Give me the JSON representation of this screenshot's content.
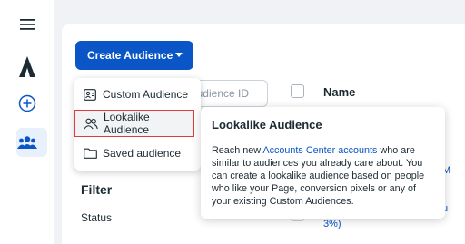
{
  "create_button": {
    "label": "Create Audience"
  },
  "search": {
    "placeholder": "udience ID"
  },
  "table": {
    "name_header": "Name"
  },
  "menu": {
    "items": [
      {
        "label": "Custom Audience",
        "icon": "custom-audience-icon"
      },
      {
        "label": "Lookalike Audience",
        "icon": "lookalike-people-icon",
        "highlighted": true
      },
      {
        "label": "Saved audience",
        "icon": "folder-icon"
      }
    ]
  },
  "filters": {
    "title": "Filter",
    "status_label": "Status"
  },
  "tooltip": {
    "title": "Lookalike Audience",
    "body_prefix": "Reach new ",
    "link_text": "Accounts Center accounts",
    "body_suffix": " who are similar to audiences you already care about. You can create a lookalike audience based on people who like your Page, conversion pixels or any of your existing Custom Audiences."
  },
  "background_fragments": {
    "row_peek_1": "M",
    "row_peek_2": "u",
    "row_peek_3": "3%)"
  },
  "colors": {
    "accent": "#0a56c6",
    "highlight_border": "#e0393e",
    "rail_active_bg": "#e7f0fb"
  }
}
